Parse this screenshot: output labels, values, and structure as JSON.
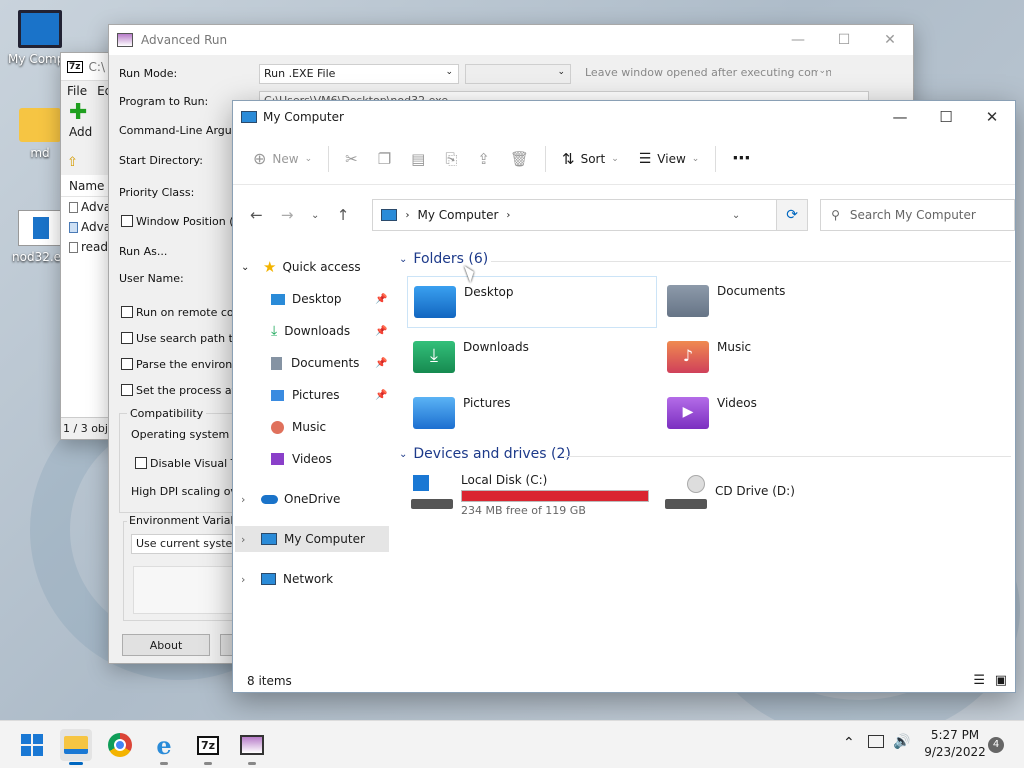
{
  "desktop": {
    "icons": [
      {
        "label": "My Compu"
      },
      {
        "label": "md"
      },
      {
        "label": "nod32.ex"
      }
    ]
  },
  "sevenzip": {
    "title": "C:\\",
    "menu": [
      "File",
      "Ed"
    ],
    "add_label": "Add",
    "add_more": "E",
    "col_name": "Name",
    "rows": [
      "Adva",
      "Adva",
      "read"
    ],
    "status": "1 / 3 obje"
  },
  "advrun": {
    "title": "Advanced Run",
    "labels": {
      "run_mode": "Run Mode:",
      "program": "Program to Run:",
      "cmdline": "Command-Line Argumen",
      "startdir": "Start Directory:",
      "priority": "Priority Class:",
      "winpos": "Window Position (X,",
      "runas": "Run As...",
      "username": "User Name:",
      "remote": "Run on remote comp",
      "searchpath": "Use search path to f",
      "parseenv": "Parse the environme",
      "affinity": "Set the process affin",
      "compat": "Compatibility",
      "oscompat": "Operating system co",
      "disablevisual": "Disable Visual The",
      "highdpi": "High DPI scaling over",
      "envvars": "Environment Variables",
      "envcombo": "Use current system"
    },
    "run_mode_value": "Run .EXE File",
    "leave_window": "Leave window opened after executing command",
    "program_value": "C:\\Users\\VM6\\Desktop\\nod32.exe",
    "about_button": "About"
  },
  "explorer": {
    "title": "My Computer",
    "toolbar": {
      "new": "New",
      "sort": "Sort",
      "view": "View",
      "more": "⋯"
    },
    "address": "My Computer",
    "search_placeholder": "Search My Computer",
    "nav": {
      "quick_access": "Quick access",
      "items": [
        "Desktop",
        "Downloads",
        "Documents",
        "Pictures",
        "Music",
        "Videos"
      ],
      "onedrive": "OneDrive",
      "mycomputer": "My Computer",
      "network": "Network"
    },
    "folders_header": "Folders (6)",
    "folders": [
      "Desktop",
      "Documents",
      "Downloads",
      "Music",
      "Pictures",
      "Videos"
    ],
    "drives_header": "Devices and drives (2)",
    "local_disk": {
      "name": "Local Disk (C:)",
      "free": "234 MB free of 119 GB",
      "used_fraction": 0.998
    },
    "cd_drive": "CD Drive (D:)",
    "status": "8 items"
  },
  "taskbar": {
    "time": "5:27 PM",
    "date": "9/23/2022",
    "notifications": "4",
    "sevenzip_label": "7z"
  },
  "colors": {
    "accent": "#0067c0",
    "disk_full": "#da2530",
    "group_header": "#1d3a8a"
  }
}
